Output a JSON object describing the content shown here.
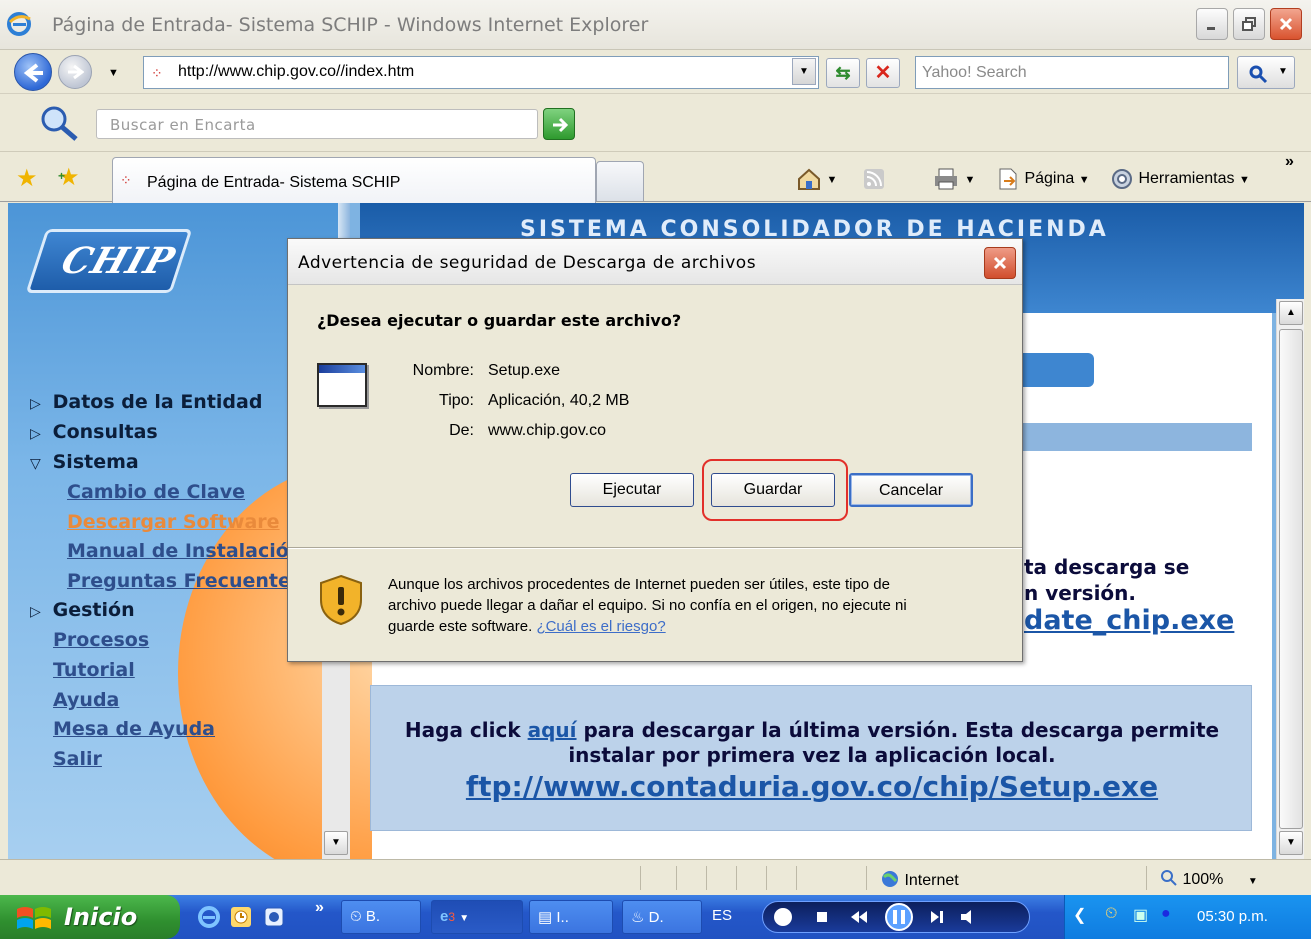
{
  "window": {
    "title": "Página de Entrada- Sistema SCHIP - Windows Internet Explorer"
  },
  "address_bar": {
    "url": "http://www.chip.gov.co//index.htm",
    "search_placeholder": "Yahoo! Search"
  },
  "encarta": {
    "placeholder": "Buscar en Encarta"
  },
  "tabs": {
    "active_label": "Página de Entrada- Sistema SCHIP"
  },
  "command_bar": {
    "page_label": "Página",
    "tools_label": "Herramientas"
  },
  "page": {
    "logo_text": "CHIP",
    "banner_title": "SISTEMA CONSOLIDADOR DE HACIENDA",
    "nav": {
      "datos": "Datos de la Entidad",
      "consultas": "Consultas",
      "sistema": "Sistema",
      "cambio": "Cambio de Clave",
      "descargar": "Descargar Software",
      "manual": "Manual de Instalación",
      "preguntas": "Preguntas Frecuentes",
      "gestion": "Gestión",
      "procesos": "Procesos",
      "tutorial": "Tutorial",
      "ayuda": "Ayuda",
      "mesa": "Mesa de Ayuda",
      "salir": "Salir"
    },
    "partial_line1": "ta descarga se",
    "partial_line2": "n versión.",
    "partial_link": "date_chip.exe",
    "download_text_pre": "Haga click ",
    "download_link": "aquí",
    "download_text_post": " para descargar la última versión. Esta descarga permite",
    "download_text_line2": "instalar por primera vez la aplicación local.",
    "ftp_link": "ftp://www.contaduria.gov.co/chip/Setup.exe"
  },
  "dialog": {
    "title": "Advertencia de seguridad de Descarga de archivos",
    "question": "¿Desea ejecutar o guardar este archivo?",
    "name_label": "Nombre:",
    "name_value": "Setup.exe",
    "type_label": "Tipo:",
    "type_value": "Aplicación, 40,2 MB",
    "from_label": "De:",
    "from_value": "www.chip.gov.co",
    "run_button": "Ejecutar",
    "save_button": "Guardar",
    "cancel_button": "Cancelar",
    "warning": "Aunque los archivos procedentes de Internet pueden ser útiles, este tipo de archivo puede llegar a dañar el equipo. Si no confía en el origen, no ejecute ni guarde este software.",
    "risk_link": "¿Cuál es el riesgo?"
  },
  "status_bar": {
    "zone": "Internet",
    "zoom": "100%"
  },
  "taskbar": {
    "start": "Inicio",
    "btn1": "B.",
    "btn2": "3",
    "btn3": "I..",
    "btn4": "D.",
    "lang": "ES",
    "clock": "05:30 p.m."
  }
}
